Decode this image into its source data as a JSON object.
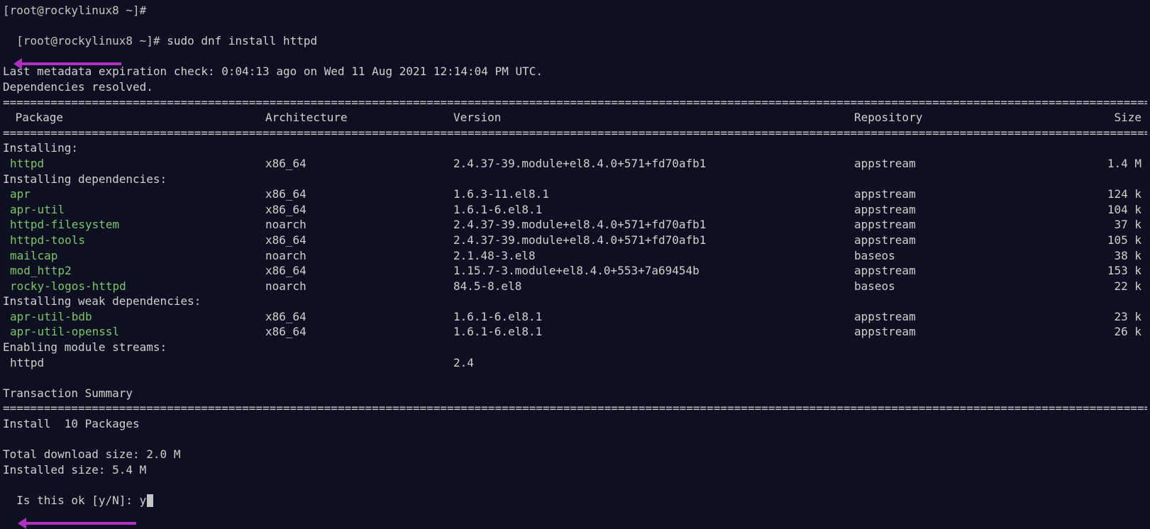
{
  "prompt1": "[root@rockylinux8 ~]#",
  "prompt2": "[root@rockylinux8 ~]# ",
  "command": "sudo dnf install httpd",
  "metadata_line": "Last metadata expiration check: 0:04:13 ago on Wed 11 Aug 2021 12:14:04 PM UTC.",
  "deps_resolved": "Dependencies resolved.",
  "separator": "================================================================================================================================================================================================",
  "headers": {
    "package": " Package",
    "arch": "Architecture",
    "version": "Version",
    "repo": "Repository",
    "size": "Size"
  },
  "groups": {
    "installing": "Installing:",
    "deps": "Installing dependencies:",
    "weak": "Installing weak dependencies:",
    "streams": "Enabling module streams:"
  },
  "rows": {
    "installing": [
      {
        "pkg": "httpd",
        "arch": "x86_64",
        "ver": "2.4.37-39.module+el8.4.0+571+fd70afb1",
        "repo": "appstream",
        "size": "1.4 M"
      }
    ],
    "deps": [
      {
        "pkg": "apr",
        "arch": "x86_64",
        "ver": "1.6.3-11.el8.1",
        "repo": "appstream",
        "size": "124 k"
      },
      {
        "pkg": "apr-util",
        "arch": "x86_64",
        "ver": "1.6.1-6.el8.1",
        "repo": "appstream",
        "size": "104 k"
      },
      {
        "pkg": "httpd-filesystem",
        "arch": "noarch",
        "ver": "2.4.37-39.module+el8.4.0+571+fd70afb1",
        "repo": "appstream",
        "size": "37 k"
      },
      {
        "pkg": "httpd-tools",
        "arch": "x86_64",
        "ver": "2.4.37-39.module+el8.4.0+571+fd70afb1",
        "repo": "appstream",
        "size": "105 k"
      },
      {
        "pkg": "mailcap",
        "arch": "noarch",
        "ver": "2.1.48-3.el8",
        "repo": "baseos",
        "size": "38 k"
      },
      {
        "pkg": "mod_http2",
        "arch": "x86_64",
        "ver": "1.15.7-3.module+el8.4.0+553+7a69454b",
        "repo": "appstream",
        "size": "153 k"
      },
      {
        "pkg": "rocky-logos-httpd",
        "arch": "noarch",
        "ver": "84.5-8.el8",
        "repo": "baseos",
        "size": "22 k"
      }
    ],
    "weak": [
      {
        "pkg": "apr-util-bdb",
        "arch": "x86_64",
        "ver": "1.6.1-6.el8.1",
        "repo": "appstream",
        "size": "23 k"
      },
      {
        "pkg": "apr-util-openssl",
        "arch": "x86_64",
        "ver": "1.6.1-6.el8.1",
        "repo": "appstream",
        "size": "26 k"
      }
    ]
  },
  "stream": {
    "name": "httpd",
    "ver": "2.4"
  },
  "summary_label": "Transaction Summary",
  "install_count": "Install  10 Packages",
  "total_dl": "Total download size: 2.0 M",
  "installed_size": "Installed size: 5.4 M",
  "confirm_prompt": "Is this ok [y/N]: ",
  "confirm_answer": "y"
}
